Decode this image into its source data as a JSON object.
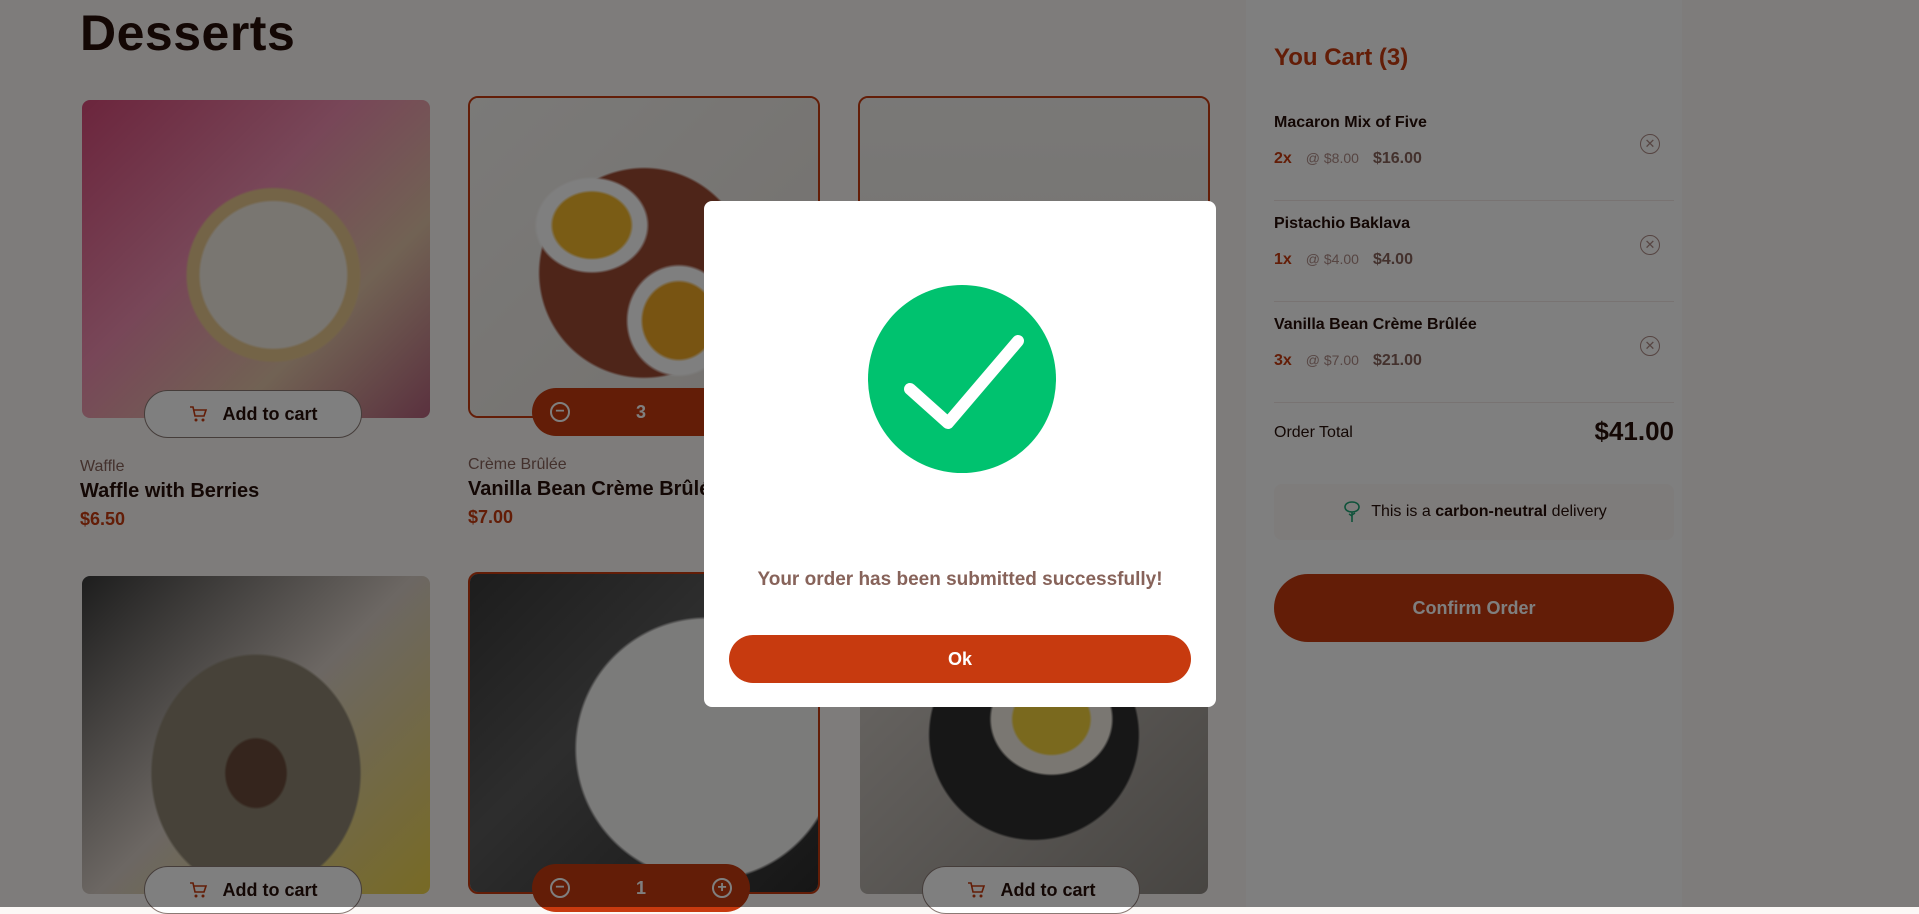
{
  "page": {
    "title": "Desserts"
  },
  "products": [
    {
      "category": "Waffle",
      "name": "Waffle with Berries",
      "price": "$6.50",
      "action_label": "Add to cart",
      "selected": false
    },
    {
      "category": "Crème Brûlée",
      "name": "Vanilla Bean Crème Brûlée",
      "price": "$7.00",
      "quantity": "3",
      "selected": true
    },
    {
      "selected": true
    },
    {
      "action_label": "Add to cart",
      "selected": false
    },
    {
      "quantity": "1",
      "selected": true
    },
    {
      "action_label": "Add to cart",
      "selected": false
    }
  ],
  "cart": {
    "title": "You Cart (3)",
    "items": [
      {
        "name": "Macaron Mix of Five",
        "qty": "2x",
        "unit_price": "@ $8.00",
        "total": "$16.00"
      },
      {
        "name": "Pistachio Baklava",
        "qty": "1x",
        "unit_price": "@ $4.00",
        "total": "$4.00"
      },
      {
        "name": "Vanilla Bean Crème Brûlée",
        "qty": "3x",
        "unit_price": "@ $7.00",
        "total": "$21.00"
      }
    ],
    "order_total_label": "Order Total",
    "order_total_value": "$41.00",
    "carbon_prefix": "This is a ",
    "carbon_bold": "carbon-neutral",
    "carbon_suffix": " delivery",
    "confirm_label": "Confirm Order"
  },
  "modal": {
    "message": "Your order has been submitted successfully!",
    "ok_label": "Ok"
  },
  "colors": {
    "accent": "#c73a0f",
    "success": "#00c26f",
    "text": "#260f08",
    "muted": "#87635a"
  },
  "icons": [
    "add-to-cart-icon",
    "decrement-icon",
    "increment-icon",
    "remove-item-icon",
    "carbon-neutral-tree-icon",
    "checkmark-icon"
  ]
}
